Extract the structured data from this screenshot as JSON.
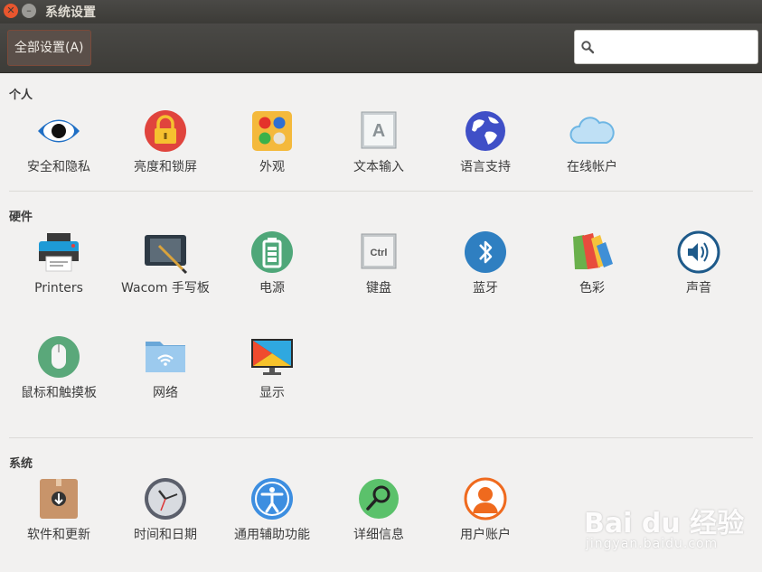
{
  "window": {
    "title": "系统设置"
  },
  "toolbar": {
    "all_settings_label": "全部设置(A)",
    "search_value": ""
  },
  "sections": {
    "personal": {
      "title": "个人",
      "items": [
        "安全和隐私",
        "亮度和锁屏",
        "外观",
        "文本输入",
        "语言支持",
        "在线帐户"
      ]
    },
    "hardware": {
      "title": "硬件",
      "items": [
        "Printers",
        "Wacom 手写板",
        "电源",
        "键盘",
        "蓝牙",
        "色彩",
        "声音",
        "鼠标和触摸板",
        "网络",
        "显示"
      ]
    },
    "system": {
      "title": "系统",
      "items": [
        "软件和更新",
        "时间和日期",
        "通用辅助功能",
        "详细信息",
        "用户账户"
      ]
    }
  },
  "icons": {
    "ctrl_key": "Ctrl",
    "text_input_letter": "A"
  },
  "watermark": {
    "brand": "Bai du 经验",
    "url": "jingyan.baidu.com"
  }
}
